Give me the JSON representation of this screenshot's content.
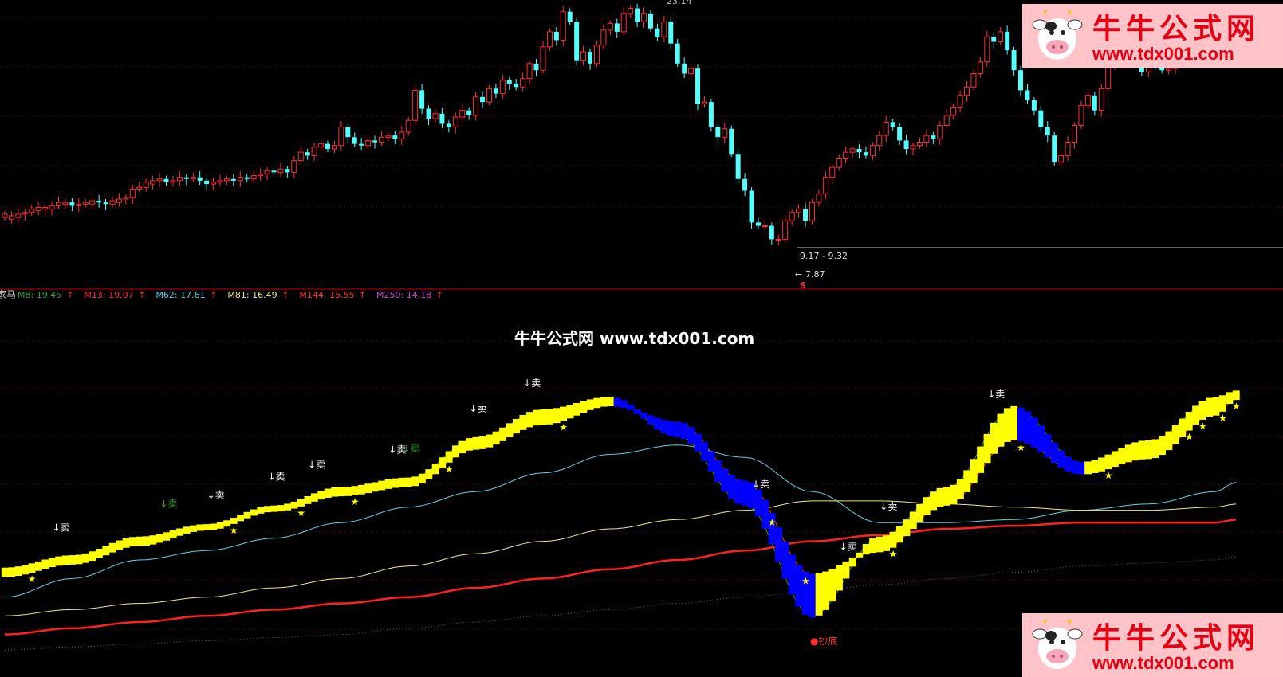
{
  "watermark": {
    "name": "牛牛公式网",
    "url": "www.tdx001.com",
    "center_text": "牛牛公式网 www.tdx001.com"
  },
  "indicator_header": {
    "name_fragment": "家马",
    "items": [
      {
        "label": "M8: 19.45",
        "color": "#2ca02c"
      },
      {
        "label": "M13: 19.07",
        "color": "#ff3030"
      },
      {
        "label": "M62: 17.61",
        "color": "#5ad1e6"
      },
      {
        "label": "M81: 16.49",
        "color": "#f0e68c"
      },
      {
        "label": "M144: 15.55",
        "color": "#ff3030"
      },
      {
        "label": "M250: 14.18",
        "color": "#cc44cc"
      }
    ]
  },
  "colors": {
    "up": "#ff3030",
    "down": "#54ffff",
    "ribbon_up": "#ffff00",
    "ribbon_down": "#0000ff",
    "m8": "#2ca02c",
    "m13": "#ff3030",
    "m62": "#5ad1e6",
    "m81": "#f0e68c",
    "m144": "#ff2020",
    "m250": "#666666",
    "grid": "#800000",
    "sell_text": "#ffffff",
    "sell_text_alt": "#2ca02c",
    "star": "#ffff00",
    "bottom_text": "#ff3030"
  },
  "annotations": {
    "high_label": "23.14",
    "low_label": "7.87",
    "range_label": "9.17 - 9.32",
    "s_marker": "S",
    "bottom_label": "●抄底",
    "star_char": "★",
    "arrow_char": "↑"
  },
  "chart_data": [
    {
      "type": "candlestick",
      "title": "",
      "xlabel": "",
      "ylabel": "",
      "ylim": [
        6.7,
        23.6
      ],
      "grid": true,
      "price_range_line": "9.17 - 9.32",
      "candles": [
        {
          "o": 10.6,
          "c": 10.8
        },
        {
          "o": 10.5,
          "c": 10.7
        },
        {
          "o": 10.6,
          "c": 10.8
        },
        {
          "o": 10.8,
          "c": 10.9
        },
        {
          "o": 10.9,
          "c": 11.1
        },
        {
          "o": 11.0,
          "c": 11.2
        },
        {
          "o": 11.1,
          "c": 11.2
        },
        {
          "o": 11.1,
          "c": 11.3
        },
        {
          "o": 11.3,
          "c": 11.5
        },
        {
          "o": 11.4,
          "c": 11.5
        },
        {
          "o": 11.5,
          "c": 11.3
        },
        {
          "o": 11.3,
          "c": 11.4
        },
        {
          "o": 11.4,
          "c": 11.5
        },
        {
          "o": 11.4,
          "c": 11.6
        },
        {
          "o": 11.6,
          "c": 11.5
        },
        {
          "o": 11.5,
          "c": 11.4
        },
        {
          "o": 11.4,
          "c": 11.6
        },
        {
          "o": 11.5,
          "c": 11.7
        },
        {
          "o": 11.7,
          "c": 11.8
        },
        {
          "o": 11.8,
          "c": 12.3
        },
        {
          "o": 12.3,
          "c": 12.4
        },
        {
          "o": 12.4,
          "c": 12.7
        },
        {
          "o": 12.6,
          "c": 12.8
        },
        {
          "o": 12.8,
          "c": 12.9
        },
        {
          "o": 12.9,
          "c": 12.7
        },
        {
          "o": 12.7,
          "c": 12.8
        },
        {
          "o": 12.8,
          "c": 13.0
        },
        {
          "o": 13.0,
          "c": 12.9
        },
        {
          "o": 12.9,
          "c": 13.0
        },
        {
          "o": 13.0,
          "c": 12.8
        },
        {
          "o": 12.8,
          "c": 12.6
        },
        {
          "o": 12.6,
          "c": 12.7
        },
        {
          "o": 12.7,
          "c": 12.8
        },
        {
          "o": 12.8,
          "c": 12.9
        },
        {
          "o": 12.9,
          "c": 12.8
        },
        {
          "o": 12.8,
          "c": 13.0
        },
        {
          "o": 13.0,
          "c": 12.9
        },
        {
          "o": 12.9,
          "c": 13.1
        },
        {
          "o": 13.1,
          "c": 13.2
        },
        {
          "o": 13.2,
          "c": 13.4
        },
        {
          "o": 13.4,
          "c": 13.3
        },
        {
          "o": 13.3,
          "c": 13.5
        },
        {
          "o": 13.5,
          "c": 13.3
        },
        {
          "o": 13.3,
          "c": 14.0
        },
        {
          "o": 14.0,
          "c": 14.5
        },
        {
          "o": 14.5,
          "c": 14.3
        },
        {
          "o": 14.3,
          "c": 14.8
        },
        {
          "o": 14.8,
          "c": 15.0
        },
        {
          "o": 15.0,
          "c": 14.7
        },
        {
          "o": 14.7,
          "c": 14.9
        },
        {
          "o": 14.9,
          "c": 16.0
        },
        {
          "o": 16.0,
          "c": 15.4
        },
        {
          "o": 15.4,
          "c": 15.0
        },
        {
          "o": 15.0,
          "c": 14.9
        },
        {
          "o": 14.9,
          "c": 15.2
        },
        {
          "o": 15.2,
          "c": 15.1
        },
        {
          "o": 15.1,
          "c": 15.4
        },
        {
          "o": 15.4,
          "c": 15.5
        },
        {
          "o": 15.5,
          "c": 15.3
        },
        {
          "o": 15.3,
          "c": 15.7
        },
        {
          "o": 15.7,
          "c": 16.4
        },
        {
          "o": 16.4,
          "c": 18.2
        },
        {
          "o": 18.2,
          "c": 17.1
        },
        {
          "o": 17.1,
          "c": 16.5
        },
        {
          "o": 16.5,
          "c": 16.8
        },
        {
          "o": 16.8,
          "c": 16.2
        },
        {
          "o": 16.2,
          "c": 16.0
        },
        {
          "o": 16.0,
          "c": 16.6
        },
        {
          "o": 16.6,
          "c": 17.0
        },
        {
          "o": 17.0,
          "c": 16.7
        },
        {
          "o": 16.7,
          "c": 17.8
        },
        {
          "o": 17.8,
          "c": 17.5
        },
        {
          "o": 17.5,
          "c": 18.3
        },
        {
          "o": 18.3,
          "c": 18.0
        },
        {
          "o": 18.0,
          "c": 18.8
        },
        {
          "o": 18.8,
          "c": 18.6
        },
        {
          "o": 18.6,
          "c": 18.4
        },
        {
          "o": 18.4,
          "c": 18.9
        },
        {
          "o": 18.9,
          "c": 19.8
        },
        {
          "o": 19.8,
          "c": 19.4
        },
        {
          "o": 19.4,
          "c": 20.8
        },
        {
          "o": 20.8,
          "c": 21.7
        },
        {
          "o": 21.7,
          "c": 21.2
        },
        {
          "o": 21.2,
          "c": 22.9
        },
        {
          "o": 22.9,
          "c": 22.3
        },
        {
          "o": 22.3,
          "c": 20.0
        },
        {
          "o": 20.0,
          "c": 20.5
        },
        {
          "o": 20.5,
          "c": 19.8
        },
        {
          "o": 19.8,
          "c": 20.9
        },
        {
          "o": 20.9,
          "c": 21.8
        },
        {
          "o": 21.8,
          "c": 22.2
        },
        {
          "o": 22.2,
          "c": 21.7
        },
        {
          "o": 21.7,
          "c": 22.8
        },
        {
          "o": 22.8,
          "c": 23.1
        },
        {
          "o": 23.1,
          "c": 22.3
        },
        {
          "o": 22.3,
          "c": 22.8
        },
        {
          "o": 22.8,
          "c": 21.9
        },
        {
          "o": 21.9,
          "c": 21.4
        },
        {
          "o": 21.4,
          "c": 22.3
        },
        {
          "o": 22.3,
          "c": 21.0
        },
        {
          "o": 21.0,
          "c": 19.8
        },
        {
          "o": 19.8,
          "c": 19.2
        },
        {
          "o": 19.2,
          "c": 19.5
        },
        {
          "o": 19.5,
          "c": 17.4
        },
        {
          "o": 17.4,
          "c": 17.5
        },
        {
          "o": 17.5,
          "c": 16.0
        },
        {
          "o": 16.0,
          "c": 15.4
        },
        {
          "o": 15.4,
          "c": 15.9
        },
        {
          "o": 15.9,
          "c": 14.4
        },
        {
          "o": 14.4,
          "c": 12.9
        },
        {
          "o": 12.9,
          "c": 12.2
        },
        {
          "o": 12.2,
          "c": 10.3
        },
        {
          "o": 10.3,
          "c": 10.1
        },
        {
          "o": 10.1,
          "c": 10.1
        },
        {
          "o": 10.1,
          "c": 9.3
        },
        {
          "o": 9.3,
          "c": 9.3
        },
        {
          "o": 9.3,
          "c": 10.4
        },
        {
          "o": 10.4,
          "c": 10.9
        },
        {
          "o": 10.9,
          "c": 11.1
        },
        {
          "o": 11.1,
          "c": 10.4
        },
        {
          "o": 10.4,
          "c": 11.5
        },
        {
          "o": 11.5,
          "c": 12.0
        },
        {
          "o": 12.0,
          "c": 13.0
        },
        {
          "o": 13.0,
          "c": 13.6
        },
        {
          "o": 13.6,
          "c": 14.1
        },
        {
          "o": 14.1,
          "c": 14.5
        },
        {
          "o": 14.5,
          "c": 14.7
        },
        {
          "o": 14.7,
          "c": 14.5
        },
        {
          "o": 14.5,
          "c": 14.3
        },
        {
          "o": 14.3,
          "c": 14.9
        },
        {
          "o": 14.9,
          "c": 15.5
        },
        {
          "o": 15.5,
          "c": 16.3
        },
        {
          "o": 16.3,
          "c": 16.0
        },
        {
          "o": 16.0,
          "c": 15.2
        },
        {
          "o": 15.2,
          "c": 14.7
        },
        {
          "o": 14.7,
          "c": 14.9
        },
        {
          "o": 14.9,
          "c": 15.1
        },
        {
          "o": 15.1,
          "c": 15.5
        },
        {
          "o": 15.5,
          "c": 15.3
        },
        {
          "o": 15.3,
          "c": 16.1
        },
        {
          "o": 16.1,
          "c": 16.7
        },
        {
          "o": 16.7,
          "c": 17.2
        },
        {
          "o": 17.2,
          "c": 17.9
        },
        {
          "o": 17.9,
          "c": 18.4
        },
        {
          "o": 18.4,
          "c": 19.2
        },
        {
          "o": 19.2,
          "c": 19.9
        },
        {
          "o": 19.9,
          "c": 21.4
        },
        {
          "o": 21.4,
          "c": 21.1
        },
        {
          "o": 21.1,
          "c": 21.7
        },
        {
          "o": 21.7,
          "c": 20.6
        },
        {
          "o": 20.6,
          "c": 19.4
        },
        {
          "o": 19.4,
          "c": 18.2
        },
        {
          "o": 18.2,
          "c": 17.6
        },
        {
          "o": 17.6,
          "c": 17.0
        },
        {
          "o": 17.0,
          "c": 16.0
        },
        {
          "o": 16.0,
          "c": 15.5
        },
        {
          "o": 15.5,
          "c": 13.9
        },
        {
          "o": 13.9,
          "c": 14.3
        },
        {
          "o": 14.3,
          "c": 15.1
        },
        {
          "o": 15.1,
          "c": 16.1
        },
        {
          "o": 16.1,
          "c": 17.3
        },
        {
          "o": 17.3,
          "c": 17.9
        },
        {
          "o": 17.9,
          "c": 17.0
        },
        {
          "o": 17.0,
          "c": 18.3
        },
        {
          "o": 18.3,
          "c": 19.7
        },
        {
          "o": 19.7,
          "c": 20.7
        },
        {
          "o": 20.7,
          "c": 21.2
        },
        {
          "o": 21.2,
          "c": 21.6
        },
        {
          "o": 21.6,
          "c": 20.4
        },
        {
          "o": 20.4,
          "c": 19.3
        },
        {
          "o": 19.3,
          "c": 20.3
        },
        {
          "o": 20.3,
          "c": 19.8
        },
        {
          "o": 19.8,
          "c": 19.4
        },
        {
          "o": 19.4,
          "c": 19.5
        },
        {
          "o": 19.5,
          "c": 19.9
        },
        {
          "o": 19.9,
          "c": 20.4
        },
        {
          "o": 20.4,
          "c": 20.3
        },
        {
          "o": 20.3,
          "c": 20.2
        },
        {
          "o": 20.2,
          "c": 20.7
        },
        {
          "o": 20.7,
          "c": 20.6
        },
        {
          "o": 20.6,
          "c": 20.9
        },
        {
          "o": 20.9,
          "c": 20.5
        },
        {
          "o": 20.5,
          "c": 20.7
        },
        {
          "o": 20.7,
          "c": 20.5
        }
      ]
    },
    {
      "type": "line",
      "title": "",
      "xlabel": "",
      "ylabel": "",
      "ylim": [
        0,
        100
      ],
      "grid": true,
      "sample_x": [
        0,
        10,
        20,
        30,
        40,
        50,
        60,
        70,
        80,
        90,
        100,
        110,
        120,
        130,
        140,
        150,
        160,
        170,
        180,
        183
      ],
      "series": [
        {
          "name": "M8",
          "values": [
            27,
            31,
            37,
            41,
            47,
            53,
            56,
            69,
            78,
            82,
            70,
            48,
            12,
            37,
            53,
            79,
            61,
            68,
            82,
            84
          ]
        },
        {
          "name": "M13",
          "values": [
            25,
            29,
            35,
            40,
            46,
            51,
            54,
            66,
            74,
            80,
            74,
            55,
            25,
            33,
            48,
            69,
            58,
            63,
            77,
            82
          ]
        },
        {
          "name": "M62",
          "values": [
            18,
            24,
            30,
            33,
            37,
            42,
            47,
            52,
            58,
            64,
            67,
            63,
            52,
            42,
            42,
            43,
            46,
            48,
            52,
            55
          ]
        },
        {
          "name": "M81",
          "values": [
            12,
            14,
            16,
            18,
            21,
            24,
            28,
            32,
            36,
            40,
            43,
            46,
            49,
            49,
            48,
            47,
            46,
            46,
            47,
            48
          ]
        },
        {
          "name": "M144",
          "values": [
            6,
            8,
            10,
            12,
            14,
            16,
            18,
            21,
            24,
            27,
            30,
            33,
            36,
            38,
            40,
            41,
            42,
            42,
            42,
            43
          ]
        },
        {
          "name": "M250",
          "values": [
            1,
            2,
            3,
            4,
            5,
            6,
            8,
            10,
            12,
            14,
            16,
            18,
            20,
            22,
            24,
            26,
            28,
            29,
            30,
            31
          ]
        }
      ],
      "sell_signals": [
        {
          "i": 8,
          "label": "↓卖"
        },
        {
          "i": 24,
          "label": "↓卖",
          "alt": true
        },
        {
          "i": 31,
          "label": "↓卖"
        },
        {
          "i": 40,
          "label": "↓卖"
        },
        {
          "i": 46,
          "label": "↓卖"
        },
        {
          "i": 58,
          "label": "↓卖"
        },
        {
          "i": 60,
          "label": "↓卖",
          "alt": true
        },
        {
          "i": 70,
          "label": "↓卖"
        },
        {
          "i": 78,
          "label": "↓卖"
        },
        {
          "i": 125,
          "label": "↓卖"
        },
        {
          "i": 112,
          "label": "↓卖"
        },
        {
          "i": 131,
          "label": "↓卖"
        },
        {
          "i": 147,
          "label": "↓卖"
        }
      ],
      "star_indices": [
        4,
        34,
        44,
        52,
        66,
        83,
        114,
        119,
        132,
        151,
        164,
        176,
        178,
        181,
        183
      ],
      "bottom_signal_index": 112
    }
  ]
}
